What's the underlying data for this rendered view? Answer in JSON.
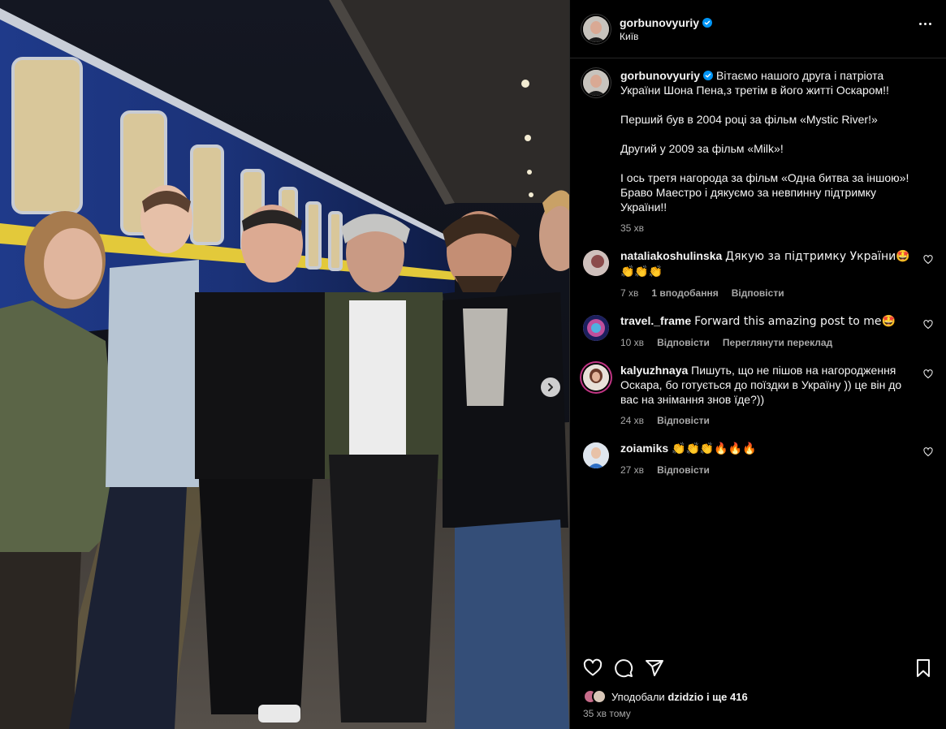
{
  "post": {
    "username": "gorbunovyuriy",
    "location": "Київ",
    "caption": {
      "line1": "Вітаємо нашого друга і патріота України Шона Пена,з третім в його житті Оскаром!!",
      "line2": "Перший був в 2004 році за фільм «Mystic River!»",
      "line3": "Другий у 2009 за фільм «Milk»!",
      "line4": "І ось третя нагорода за фільм «Одна битва за іншою»! Браво Маестро і дякуємо за невпинну підтримку України!!",
      "time": "35 хв"
    }
  },
  "comments": [
    {
      "user": "nataliakoshulinska",
      "text": "Дякую за підтримку України🤩👏👏👏",
      "time": "7 хв",
      "likes": "1 вподобання",
      "reply": "Відповісти"
    },
    {
      "user": "travel._frame",
      "text": "Forward this amazing post to me🤩",
      "time": "10 хв",
      "reply": "Відповісти",
      "translate": "Переглянути переклад"
    },
    {
      "user": "kalyuzhnaya",
      "text": "Пишуть, що не пішов на нагородження Оскара, бо готується до поїздки в Україну )) це він до вас на знімання знов їде?))",
      "time": "24 хв",
      "reply": "Відповісти"
    },
    {
      "user": "zoiamiks",
      "text": "👏👏👏🔥🔥🔥",
      "time": "27 хв",
      "reply": "Відповісти"
    }
  ],
  "likes": {
    "prefix": "Уподобали ",
    "user": "dzidzio",
    "suffix": " і ще 416"
  },
  "posted_ago": "35 хв тому",
  "icons": [
    "verified-badge",
    "more-options",
    "heart",
    "comment",
    "share",
    "bookmark",
    "carousel-next-chevron"
  ],
  "colors": {
    "verified": "#0095f6",
    "panel_bg": "#000000",
    "secondary_text": "#a8a8a8"
  }
}
